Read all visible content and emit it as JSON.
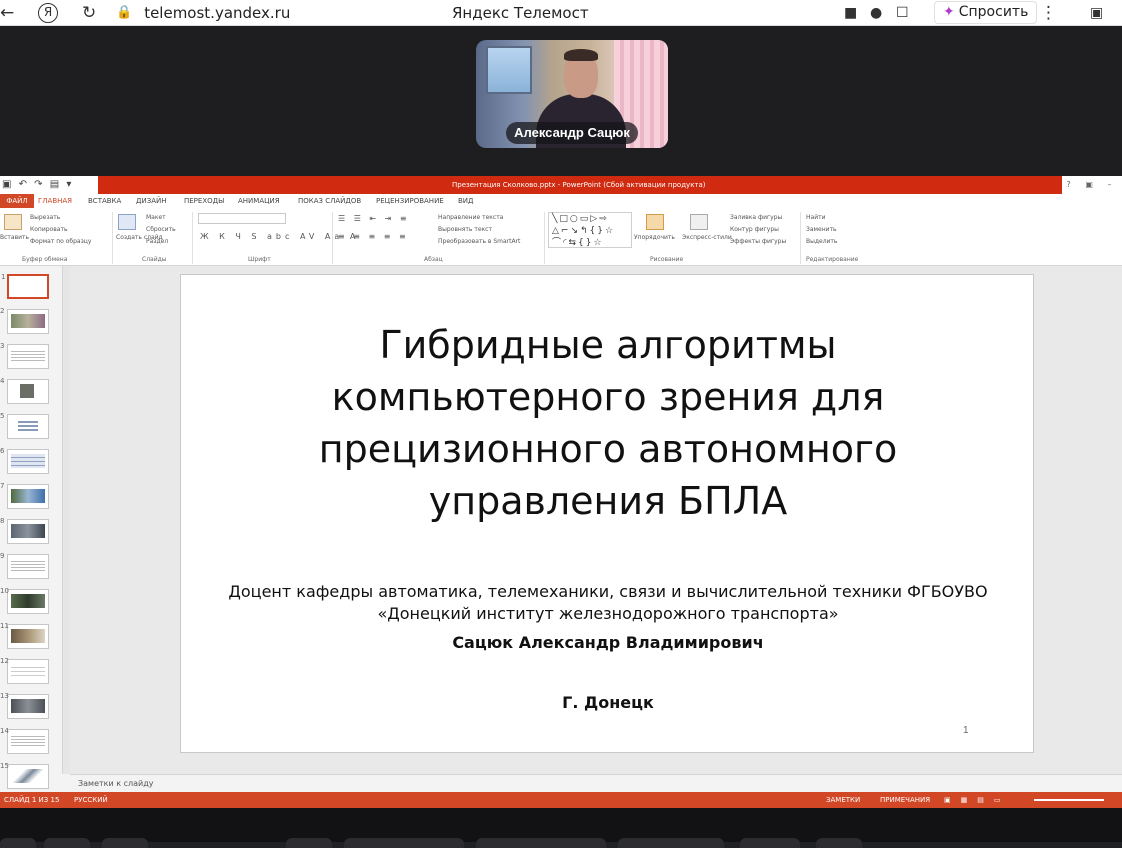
{
  "browser": {
    "url": "telemost.yandex.ru",
    "tab_title": "Яндекс Телемост",
    "ask_label": "Спросить"
  },
  "call": {
    "participant_name": "Александр Сацюк"
  },
  "powerpoint": {
    "window_title": "Презентация Сколково.pptx - PowerPoint (Сбой активации продукта)",
    "tabs": [
      "ФАЙЛ",
      "ГЛАВНАЯ",
      "ВСТАВКА",
      "ДИЗАЙН",
      "ПЕРЕХОДЫ",
      "АНИМАЦИЯ",
      "ПОКАЗ СЛАЙДОВ",
      "РЕЦЕНЗИРОВАНИЕ",
      "ВИД"
    ],
    "ribbon": {
      "paste": "Вставить",
      "cut": "Вырезать",
      "copy": "Копировать",
      "format_painter": "Формат по образцу",
      "new_slide": "Создать слайд",
      "layout": "Макет",
      "reset": "Сбросить",
      "section": "Раздел",
      "text_direction": "Направление текста",
      "align_text": "Выровнять текст",
      "smartart": "Преобразовать в SmartArt",
      "arrange": "Упорядочить",
      "quick_styles": "Экспресс-стили",
      "shape_fill": "Заливка фигуры",
      "shape_outline": "Контур фигуры",
      "shape_effects": "Эффекты фигуры",
      "find": "Найти",
      "replace": "Заменить",
      "select": "Выделить",
      "groups": {
        "clipboard": "Буфер обмена",
        "slides": "Слайды",
        "font": "Шрифт",
        "paragraph": "Абзац",
        "drawing": "Рисование",
        "editing": "Редактирование"
      }
    },
    "slide": {
      "title": "Гибридные алгоритмы компьютерного зрения для прецизионного автономного управления БПЛА",
      "subtitle": "Доцент кафедры автоматика, телемеханики, связи и вычислительной техники ФГБОУВО «Донецкий институт железнодорожного транспорта»",
      "author": "Сацюк Александр Владимирович",
      "city": "Г. Донецк",
      "number": "1"
    },
    "notes_placeholder": "Заметки к слайду",
    "status": {
      "slide_counter": "СЛАЙД 1 ИЗ 15",
      "language": "РУССКИЙ",
      "notes": "ЗАМЕТКИ",
      "comments": "ПРИМЕЧАНИЯ"
    },
    "thumbnail_count": 15
  }
}
